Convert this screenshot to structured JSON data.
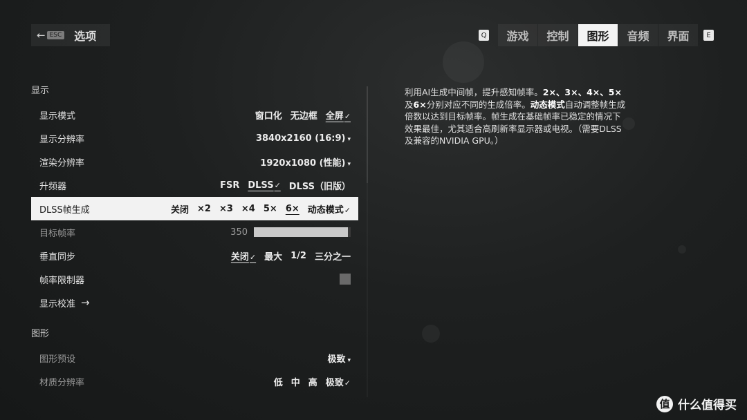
{
  "header": {
    "back_key": "ESC",
    "back_label": "选项",
    "prev_key": "Q",
    "next_key": "E",
    "tabs": [
      {
        "label": "游戏",
        "active": false
      },
      {
        "label": "控制",
        "active": false
      },
      {
        "label": "图形",
        "active": true
      },
      {
        "label": "音频",
        "active": false
      },
      {
        "label": "界面",
        "active": false
      }
    ]
  },
  "settings": {
    "display_section": "显示",
    "display_mode": {
      "label": "显示模式",
      "options": [
        "窗口化",
        "无边框",
        "全屏"
      ],
      "selected": "全屏"
    },
    "display_resolution": {
      "label": "显示分辨率",
      "value": "3840x2160 (16:9)"
    },
    "render_resolution": {
      "label": "渲染分辨率",
      "value": "1920x1080 (性能)"
    },
    "upscaler": {
      "label": "升频器",
      "options": [
        "FSR",
        "DLSS",
        "DLSS（旧版）"
      ],
      "selected": "DLSS"
    },
    "dlss_framegen": {
      "label": "DLSS帧生成",
      "options": [
        "关闭",
        "×2",
        "×3",
        "×4",
        "5×",
        "6×",
        "动态模式"
      ],
      "selected": "6×"
    },
    "target_fps": {
      "label": "目标帧率",
      "value": "350",
      "fill_fraction": 0.97
    },
    "vsync": {
      "label": "垂直同步",
      "options": [
        "关闭",
        "最大",
        "1/2",
        "三分之一"
      ],
      "selected": "关闭"
    },
    "fps_limiter": {
      "label": "帧率限制器",
      "enabled": false
    },
    "display_calibration": {
      "label": "显示校准"
    },
    "graphics_section": "图形",
    "graphics_preset": {
      "label": "图形预设",
      "value": "极致"
    },
    "texture_resolution": {
      "label": "材质分辨率",
      "options": [
        "低",
        "中",
        "高",
        "极致"
      ],
      "selected": "极致"
    }
  },
  "description": {
    "p1": "利用AI生成中间帧，提升感知帧率。",
    "p2": "2×、3×、4×、5×",
    "p3": "及",
    "p4": "6×",
    "p5": "分别对应不同的生成倍率。",
    "p6": "动态模式",
    "p7": "自动调整帧生成倍数以达到目标帧率。帧生成在基础帧率已稳定的情况下效果最佳，尤其适合高刷新率显示器或电视。（需要DLSS及兼容的NVIDIA GPU。）"
  },
  "watermark": {
    "logo": "值",
    "text": "什么值得买"
  }
}
